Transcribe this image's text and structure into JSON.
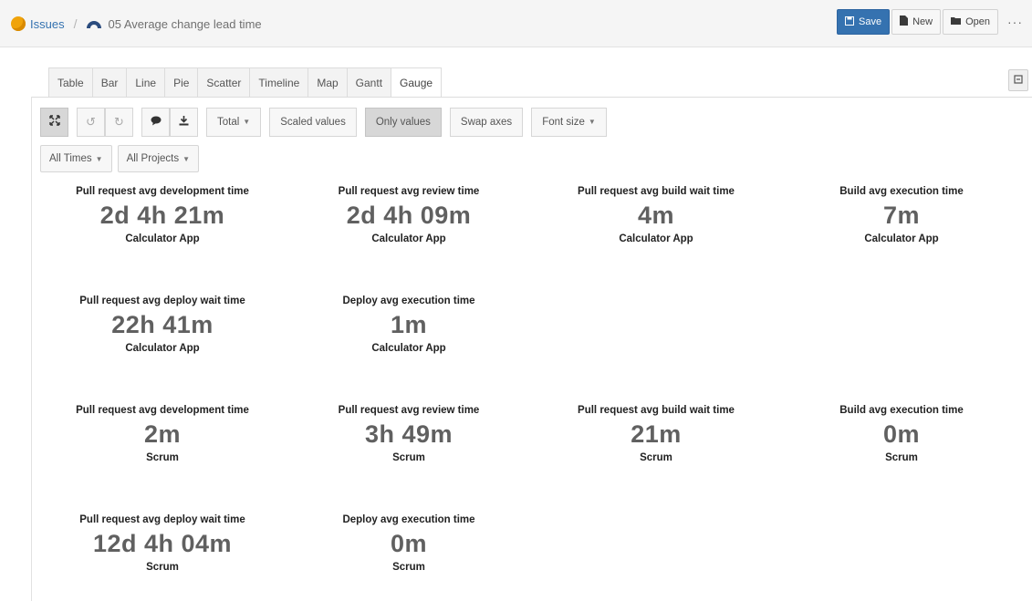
{
  "header": {
    "breadcrumb_root": "Issues",
    "report_title": "05 Average change lead time",
    "save_label": "Save",
    "new_label": "New",
    "open_label": "Open",
    "more_label": "···"
  },
  "tabs": [
    "Table",
    "Bar",
    "Line",
    "Pie",
    "Scatter",
    "Timeline",
    "Map",
    "Gantt",
    "Gauge"
  ],
  "active_tab": "Gauge",
  "toolbar": {
    "total_label": "Total",
    "scaled_label": "Scaled values",
    "only_values_label": "Only values",
    "swap_axes_label": "Swap axes",
    "font_size_label": "Font size"
  },
  "filters": {
    "times_label": "All Times",
    "projects_label": "All Projects"
  },
  "gauges": [
    {
      "title": "Pull request avg development time",
      "value": "2d 4h 21m",
      "project": "Calculator App"
    },
    {
      "title": "Pull request avg review time",
      "value": "2d 4h 09m",
      "project": "Calculator App"
    },
    {
      "title": "Pull request avg build wait time",
      "value": "4m",
      "project": "Calculator App"
    },
    {
      "title": "Build avg execution time",
      "value": "7m",
      "project": "Calculator App"
    },
    {
      "title": "Pull request avg deploy wait time",
      "value": "22h 41m",
      "project": "Calculator App"
    },
    {
      "title": "Deploy avg execution time",
      "value": "1m",
      "project": "Calculator App"
    },
    {
      "title": "Pull request avg development time",
      "value": "2m",
      "project": "Scrum"
    },
    {
      "title": "Pull request avg review time",
      "value": "3h 49m",
      "project": "Scrum"
    },
    {
      "title": "Pull request avg build wait time",
      "value": "21m",
      "project": "Scrum"
    },
    {
      "title": "Build avg execution time",
      "value": "0m",
      "project": "Scrum"
    },
    {
      "title": "Pull request avg deploy wait time",
      "value": "12d 4h 04m",
      "project": "Scrum"
    },
    {
      "title": "Deploy avg execution time",
      "value": "0m",
      "project": "Scrum"
    }
  ],
  "colors": {
    "accent": "#3572b0",
    "issues_icon": "#f0a30a",
    "value_text": "#606060"
  }
}
